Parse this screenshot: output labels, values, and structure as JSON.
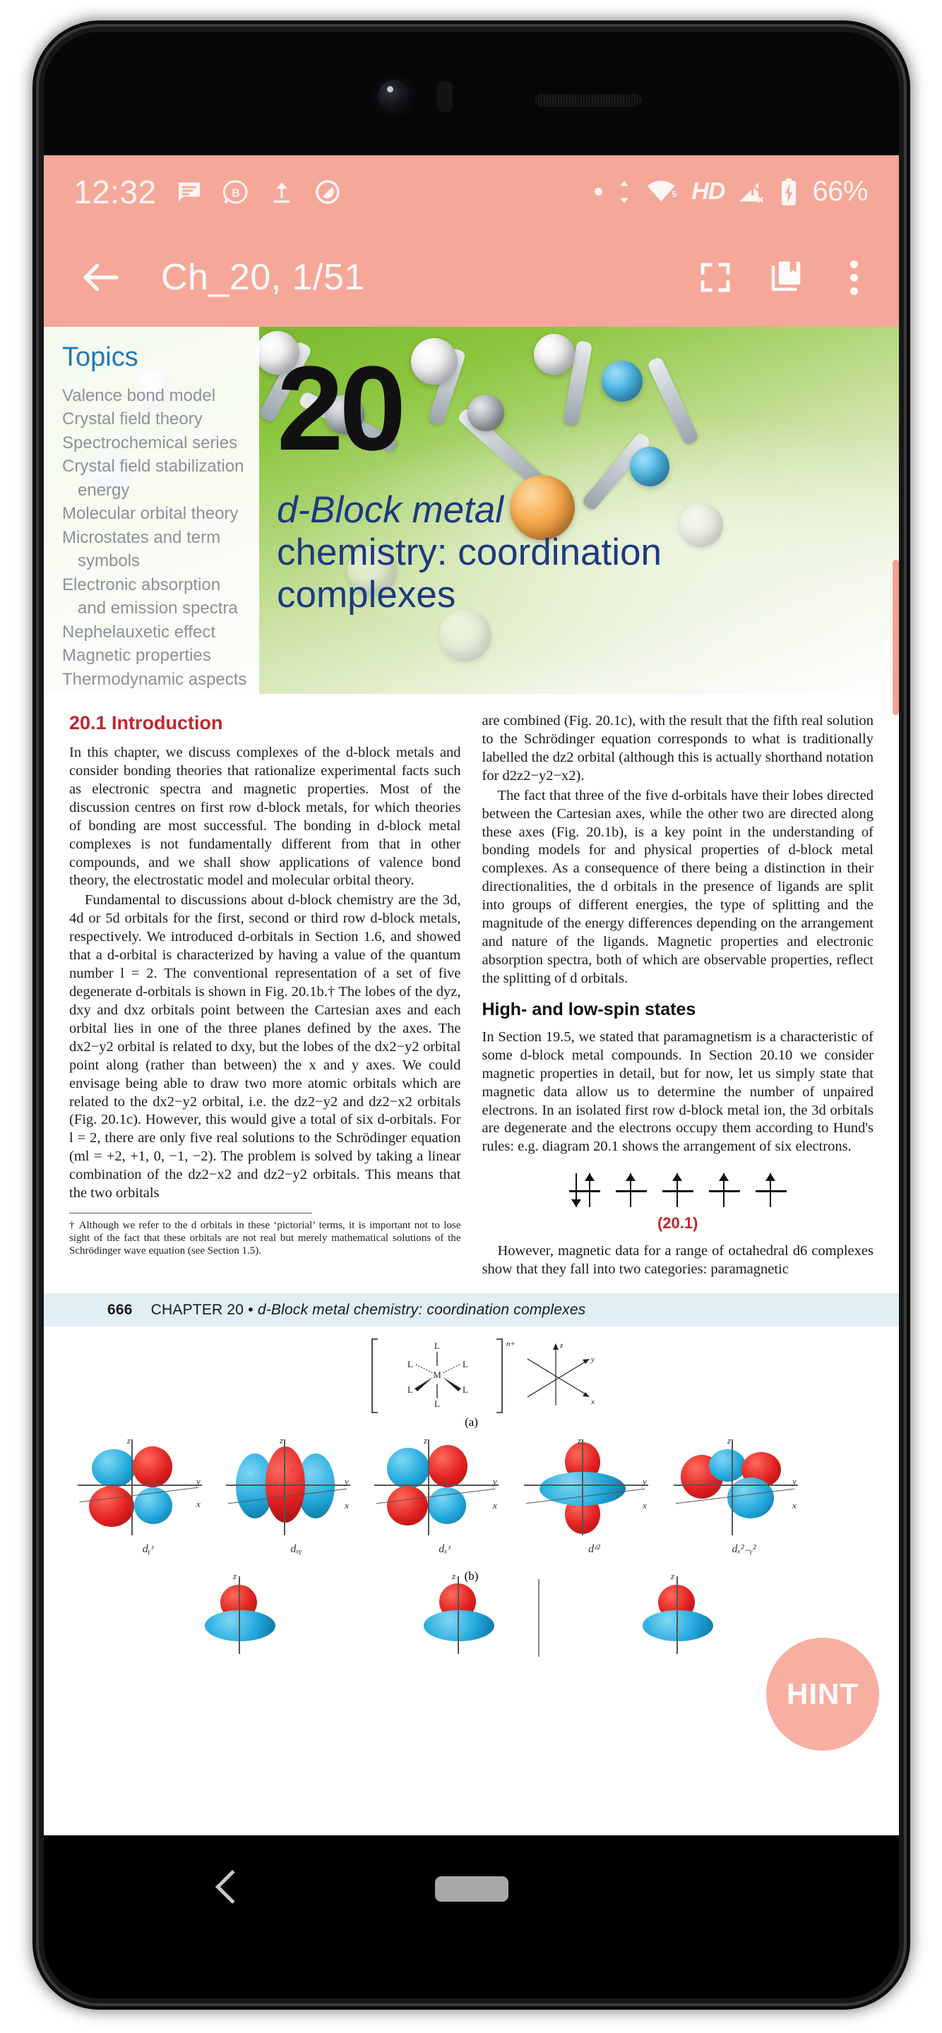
{
  "status_bar": {
    "time": "12:32",
    "left_icons": [
      {
        "name": "notes-notification-icon",
        "label": "notes"
      },
      {
        "name": "bluetooth-chat-b-icon",
        "label": "B"
      },
      {
        "name": "upload-icon",
        "label": "upload"
      },
      {
        "name": "do-not-disturb-icon",
        "label": "dnd"
      }
    ],
    "right": {
      "dot_indicator": "•",
      "data_transfer_icon": "data-transfer-icon",
      "wifi_icon": "wifi-icon",
      "wifi_badge": "5",
      "hd_label": "HD",
      "signal_icon": "signal-no-service-icon",
      "battery_icon": "battery-charging-icon",
      "battery_percent": "66%"
    }
  },
  "app_bar": {
    "back_icon": "back-arrow-icon",
    "title": "Ch_20, 1/51",
    "actions": [
      {
        "name": "fullscreen-icon",
        "label": "Fullscreen"
      },
      {
        "name": "bookmark-library-icon",
        "label": "Bookmarks"
      },
      {
        "name": "overflow-menu-icon",
        "label": "More options"
      }
    ]
  },
  "fab": {
    "label": "HINT"
  },
  "nav_bar": {
    "back": "nav-back-icon",
    "home": "nav-home-pill"
  },
  "document": {
    "chapter_number": "20",
    "chapter_title_line1": "d-Block metal",
    "chapter_title_line2": "chemistry: coordination",
    "chapter_title_line3": "complexes",
    "topics_heading": "Topics",
    "topics": [
      "Valence bond model",
      "Crystal field theory",
      "Spectrochemical series",
      "Crystal field stabilization",
      "energy",
      "Molecular orbital theory",
      "Microstates and term",
      "symbols",
      "Electronic absorption",
      "and emission spectra",
      "Nephelauxetic effect",
      "Magnetic properties",
      "Thermodynamic aspects"
    ],
    "section_heading": "20.1 Introduction",
    "left_column": {
      "para1": "In this chapter, we discuss complexes of the d-block metals and consider bonding theories that rationalize experimental facts such as electronic spectra and magnetic properties. Most of the discussion centres on first row d-block metals, for which theories of bonding are most successful. The bonding in d-block metal complexes is not fundamentally different from that in other compounds, and we shall show applications of valence bond theory, the electrostatic model and molecular orbital theory.",
      "para2": "Fundamental to discussions about d-block chemistry are the 3d, 4d or 5d orbitals for the first, second or third row d-block metals, respectively. We introduced d-orbitals in Section 1.6, and showed that a d-orbital is characterized by having a value of the quantum number l = 2. The conventional representation of a set of five degenerate d-orbitals is shown in Fig. 20.1b.† The lobes of the dyz, dxy and dxz orbitals point between the Cartesian axes and each orbital lies in one of the three planes defined by the axes. The dx2−y2 orbital is related to dxy, but the lobes of the dx2−y2 orbital point along (rather than between) the x and y axes. We could envisage being able to draw two more atomic orbitals which are related to the dx2−y2 orbital, i.e. the dz2−y2 and dz2−x2 orbitals (Fig. 20.1c). However, this would give a total of six d-orbitals. For l = 2, there are only five real solutions to the Schrödinger equation (ml = +2, +1, 0, −1, −2). The problem is solved by taking a linear combination of the dz2−x2 and dz2−y2 orbitals. This means that the two orbitals",
      "footnote": "† Although we refer to the d orbitals in these ‘pictorial’ terms, it is important not to lose sight of the fact that these orbitals are not real but merely mathematical solutions of the Schrödinger wave equation (see Section 1.5)."
    },
    "right_column": {
      "para1": "are combined (Fig. 20.1c), with the result that the fifth real solution to the Schrödinger equation corresponds to what is traditionally labelled the dz2 orbital (although this is actually shorthand notation for d2z2−y2−x2).",
      "para2": "The fact that three of the five d-orbitals have their lobes directed between the Cartesian axes, while the other two are directed along these axes (Fig. 20.1b), is a key point in the understanding of bonding models for and physical properties of d-block metal complexes. As a consequence of there being a distinction in their directionalities, the d orbitals in the presence of ligands are split into groups of different energies, the type of splitting and the magnitude of the energy differences depending on the arrangement and nature of the ligands. Magnetic properties and electronic absorption spectra, both of which are observable properties, reflect the splitting of d orbitals.",
      "sub_heading": "High- and low-spin states",
      "para3": "In Section 19.5, we stated that paramagnetism is a characteristic of some d-block metal compounds. In Section 20.10 we consider magnetic properties in detail, but for now, let us simply state that magnetic data allow us to determine the number of unpaired electrons. In an isolated first row d-block metal ion, the 3d orbitals are degenerate and the electrons occupy them according to Hund's rules: e.g. diagram 20.1 shows the arrangement of six electrons.",
      "diagram_label": "(20.1)",
      "para4": "However, magnetic data for a range of octahedral d6 complexes show that they fall into two categories: paramagnetic"
    },
    "figure_page": {
      "page_number": "666",
      "running_head_chapter": "CHAPTER 20",
      "running_head_bullet": "•",
      "running_head_title": "d-Block metal chemistry: coordination complexes",
      "fig_a_label": "(a)",
      "fig_b_label": "(b)",
      "complex_center": "M",
      "complex_ligand": "L",
      "complex_charge": "n+",
      "axis_labels": [
        "z",
        "y",
        "x"
      ],
      "orbital_labels": [
        "dᵧᶻ",
        "dₓᵧ",
        "dₓᶻ",
        "dᶻ²",
        "dₓ²₋ᵧ²"
      ]
    }
  },
  "colors": {
    "accent": "#f5a899",
    "topics_blue": "#2176b8",
    "title_navy": "#1d3a80",
    "section_red": "#c0272d",
    "running_head_bg": "#e2eef6"
  }
}
